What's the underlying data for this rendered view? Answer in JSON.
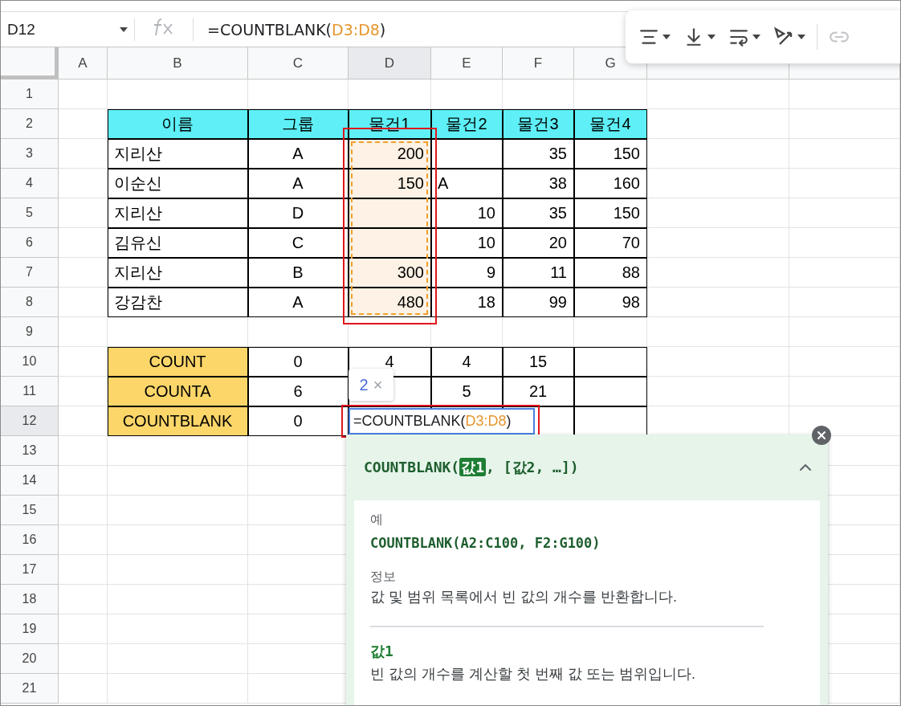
{
  "name_box": {
    "value": "D12"
  },
  "formula_bar": {
    "prefix": "=COUNTBLANK(",
    "range": "D3:D8",
    "suffix": ")"
  },
  "columns": [
    {
      "label": "A",
      "selected": false
    },
    {
      "label": "B",
      "selected": false
    },
    {
      "label": "C",
      "selected": false
    },
    {
      "label": "D",
      "selected": true
    },
    {
      "label": "E",
      "selected": false
    },
    {
      "label": "F",
      "selected": false
    },
    {
      "label": "G",
      "selected": false
    }
  ],
  "rows": [
    {
      "label": "1",
      "selected": false,
      "cells": []
    },
    {
      "label": "2",
      "selected": false,
      "cells": [
        {
          "kind": "head",
          "text": "이름"
        },
        {
          "kind": "head",
          "text": "그룹"
        },
        {
          "kind": "head",
          "text": "물건1"
        },
        {
          "kind": "head",
          "text": "물건2"
        },
        {
          "kind": "head",
          "text": "물건3"
        },
        {
          "kind": "head",
          "text": "물건4"
        }
      ]
    },
    {
      "label": "3",
      "selected": false,
      "cells": [
        {
          "kind": "text",
          "text": "지리산"
        },
        {
          "kind": "center",
          "text": "A"
        },
        {
          "kind": "range",
          "text": "200"
        },
        {
          "kind": "box"
        },
        {
          "kind": "num",
          "text": "35"
        },
        {
          "kind": "num",
          "text": "150"
        }
      ]
    },
    {
      "label": "4",
      "selected": false,
      "cells": [
        {
          "kind": "text",
          "text": "이순신"
        },
        {
          "kind": "center",
          "text": "A"
        },
        {
          "kind": "range",
          "text": "150"
        },
        {
          "kind": "text",
          "text": "A"
        },
        {
          "kind": "num",
          "text": "38"
        },
        {
          "kind": "num",
          "text": "160"
        }
      ]
    },
    {
      "label": "5",
      "selected": false,
      "cells": [
        {
          "kind": "text",
          "text": "지리산"
        },
        {
          "kind": "center",
          "text": "D"
        },
        {
          "kind": "range"
        },
        {
          "kind": "num",
          "text": "10"
        },
        {
          "kind": "num",
          "text": "35"
        },
        {
          "kind": "num",
          "text": "150"
        }
      ]
    },
    {
      "label": "6",
      "selected": false,
      "cells": [
        {
          "kind": "text",
          "text": "김유신"
        },
        {
          "kind": "center",
          "text": "C"
        },
        {
          "kind": "range"
        },
        {
          "kind": "num",
          "text": "10"
        },
        {
          "kind": "num",
          "text": "20"
        },
        {
          "kind": "num",
          "text": "70"
        }
      ]
    },
    {
      "label": "7",
      "selected": false,
      "cells": [
        {
          "kind": "text",
          "text": "지리산"
        },
        {
          "kind": "center",
          "text": "B"
        },
        {
          "kind": "range",
          "text": "300"
        },
        {
          "kind": "num",
          "text": "9"
        },
        {
          "kind": "num",
          "text": "11"
        },
        {
          "kind": "num",
          "text": "88"
        }
      ]
    },
    {
      "label": "8",
      "selected": false,
      "cells": [
        {
          "kind": "text",
          "text": "강감찬"
        },
        {
          "kind": "center",
          "text": "A"
        },
        {
          "kind": "range",
          "text": "480"
        },
        {
          "kind": "num",
          "text": "18"
        },
        {
          "kind": "num",
          "text": "99"
        },
        {
          "kind": "num",
          "text": "98"
        }
      ]
    },
    {
      "label": "9",
      "selected": false,
      "cells": []
    },
    {
      "label": "10",
      "selected": false,
      "cells": [
        {
          "kind": "func",
          "text": "COUNT"
        },
        {
          "kind": "center",
          "text": "0"
        },
        {
          "kind": "center",
          "text": "4"
        },
        {
          "kind": "center",
          "text": "4"
        },
        {
          "kind": "center",
          "text": "15"
        },
        {
          "kind": "box"
        }
      ]
    },
    {
      "label": "11",
      "selected": false,
      "cells": [
        {
          "kind": "func",
          "text": "COUNTA"
        },
        {
          "kind": "center",
          "text": "6"
        },
        {
          "kind": "box"
        },
        {
          "kind": "center",
          "text": "5"
        },
        {
          "kind": "center",
          "text": "21"
        },
        {
          "kind": "box"
        }
      ]
    },
    {
      "label": "12",
      "selected": true,
      "cells": [
        {
          "kind": "func",
          "text": "COUNTBLANK"
        },
        {
          "kind": "center",
          "text": "0"
        },
        {
          "kind": "box"
        },
        {
          "kind": "box"
        },
        {
          "kind": "box"
        },
        {
          "kind": "box"
        }
      ]
    },
    {
      "label": "13",
      "selected": false,
      "cells": []
    },
    {
      "label": "14",
      "selected": false,
      "cells": []
    },
    {
      "label": "15",
      "selected": false,
      "cells": []
    },
    {
      "label": "16",
      "selected": false,
      "cells": []
    },
    {
      "label": "17",
      "selected": false,
      "cells": []
    },
    {
      "label": "18",
      "selected": false,
      "cells": []
    },
    {
      "label": "19",
      "selected": false,
      "cells": []
    },
    {
      "label": "20",
      "selected": false,
      "cells": []
    },
    {
      "label": "21",
      "selected": false,
      "cells": []
    }
  ],
  "cell_editor": {
    "prefix": "=COUNTBLANK(",
    "range": "D3:D8",
    "suffix": ")"
  },
  "argument_hint": {
    "count": "2",
    "close": "×"
  },
  "help_panel": {
    "expanded": true,
    "signature": {
      "name": "COUNTBLANK(",
      "active_argument": "값1",
      "rest": ", [값2, …])"
    },
    "sections": [
      {
        "kind": "example",
        "heading": "예",
        "body": "COUNTBLANK(A2:C100, F2:G100)"
      },
      {
        "kind": "info",
        "heading": "정보",
        "body": "값 및 범위 목록에서 빈 값의 개수를 반환합니다."
      },
      {
        "kind": "argument",
        "heading": "값1",
        "body": "빈 값의 개수를 계산할 첫 번째 값 또는 범위입니다."
      }
    ]
  }
}
